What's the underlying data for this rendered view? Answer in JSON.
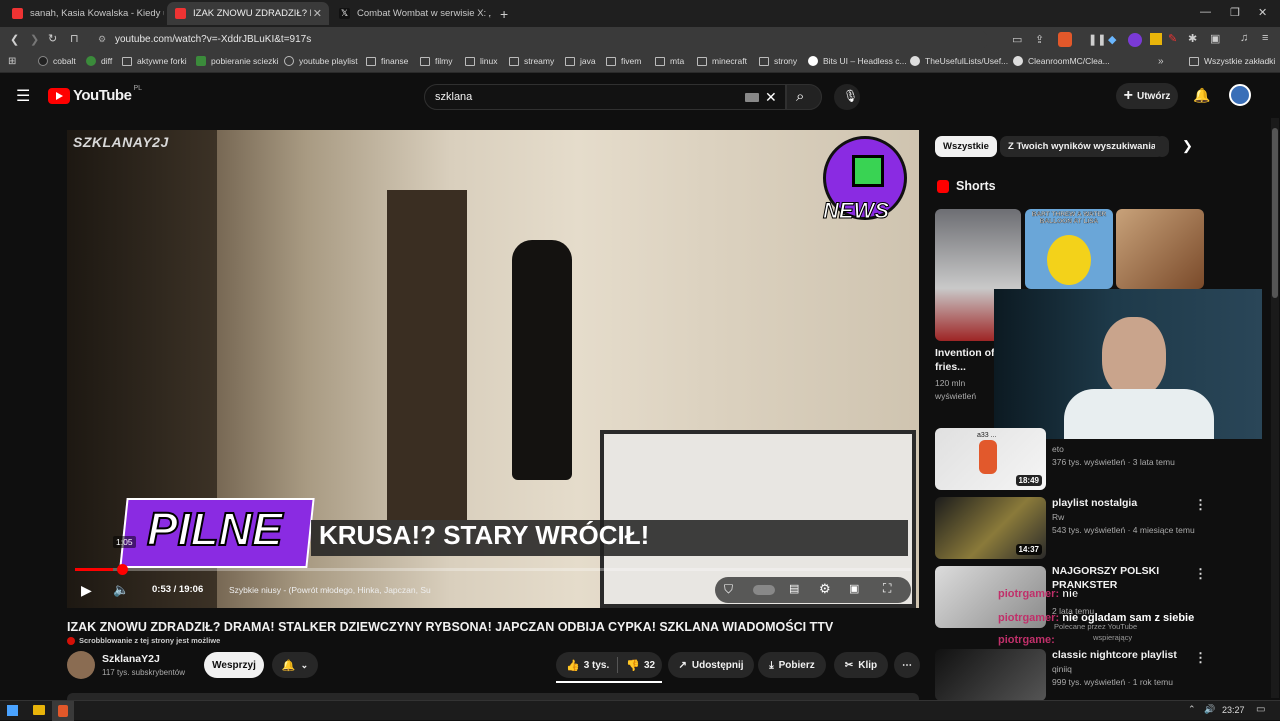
{
  "tabs": [
    {
      "title": "sanah, Kasia Kowalska - Kiedy umrę",
      "fav": "#e33"
    },
    {
      "title": "IZAK ZNOWU ZDRADZIŁ? DRAM",
      "fav": "#e33"
    },
    {
      "title": "Combat Wombat w serwisie X: „Once",
      "fav": "#222"
    }
  ],
  "address": {
    "url": "youtube.com/watch?v=-XddrJBLuKI&t=917s"
  },
  "bookmarks": [
    "cobalt",
    "diff",
    "aktywne forki",
    "pobieranie sciezki",
    "youtube playlist",
    "finanse",
    "filmy",
    "linux",
    "streamy",
    "java",
    "fivem",
    "mta",
    "minecraft",
    "strony",
    "Bits UI – Headless c...",
    "TheUsefulLists/Usef...",
    "CleanroomMC/Clea..."
  ],
  "bookmarks_all": "Wszystkie zakładki",
  "yt": {
    "logo": "YouTube",
    "country": "PL",
    "search_value": "szklana",
    "create_label": "Utwórz"
  },
  "player": {
    "channel_watermark": "SZKLANAY2J",
    "news_badge": "NEWS",
    "banner_tag": "PILNE",
    "banner_text": "KRUSA!? STARY WRÓCIŁ!",
    "hover_time": "1:05",
    "time": "0:53 / 19:06",
    "chapter": "Szybkie niusy - (Powrót młodego, Hinka, Japczan, Su",
    "progress": 0.046
  },
  "video": {
    "title": "IZAK ZNOWU ZDRADZIŁ? DRAMA! STALKER DZIEWCZYNY RYBSONA! JAPCZAN ODBIJA CYPKA! SZKLANA WIADOMOŚCI TTV",
    "scrobble": "Scrobblowanie z tej strony jest możliwe",
    "channel": "SzklanaY2J",
    "subs": "117 tys. subskrybentów",
    "support": "Wesprzyj",
    "likes": "3 tys.",
    "dislikes": "32",
    "share": "Udostępnij",
    "download": "Pobierz",
    "clip": "Klip"
  },
  "filters": [
    "Wszystkie",
    "Z Twoich wyników wyszukiwania"
  ],
  "shorts": {
    "heading": "Shorts",
    "items": [
      {
        "title": "Invention of fries...",
        "views": "120 mln wyświetleń"
      },
      {
        "title": "BART THREW A WATER BALLOON AT LISA",
        "views": ""
      }
    ]
  },
  "related": [
    {
      "title": "",
      "channel": "eto",
      "meta": "376 tys. wyświetleń · 3 lata temu",
      "duration": "18:49",
      "overlay": "a33 ..."
    },
    {
      "title": "playlist nostalgia",
      "channel": "Rw",
      "meta": "543 tys. wyświetleń · 4 miesiące temu",
      "duration": "14:37"
    },
    {
      "title": "NAJGORSZY POLSKI PRANKSTER",
      "channel": "",
      "meta": "2 lata temu",
      "duration": ""
    },
    {
      "title": "classic nightcore playlist",
      "channel": "qiniiq",
      "meta": "999 tys. wyświetleń · 1 rok temu",
      "duration": ""
    }
  ],
  "chat": [
    {
      "user": "piotrgamer:",
      "text": "nie"
    },
    {
      "user": "piotrgamer:",
      "text": "nie ogladam sam z siebie"
    },
    {
      "user": "piotrgame:",
      "text": ""
    }
  ],
  "chat_sub": "Polecane przez YouTube",
  "chat_sub2": "wspierający",
  "clock": "23:27",
  "colors": {
    "accent": "#ff0000",
    "purple": "#8a2be2"
  }
}
